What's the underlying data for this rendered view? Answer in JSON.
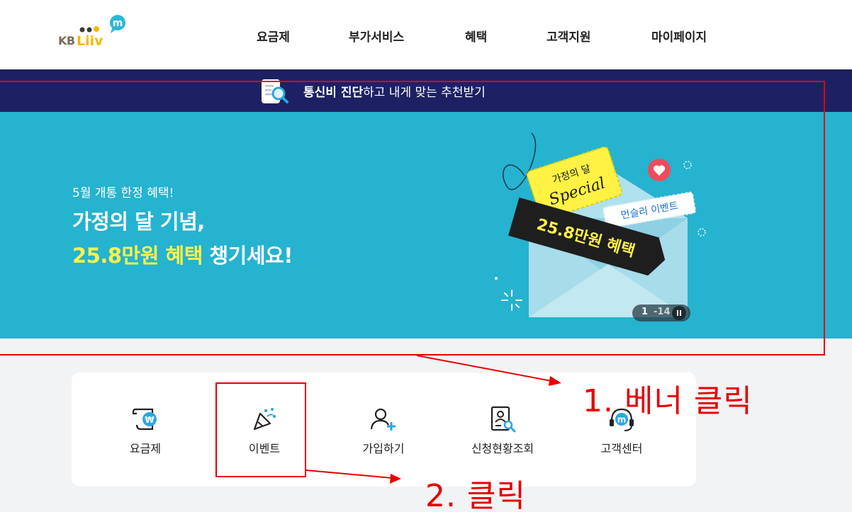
{
  "header": {
    "logo_prefix": "KB",
    "logo_brand": "Liiv M",
    "nav": [
      {
        "label": "요금제"
      },
      {
        "label": "부가서비스"
      },
      {
        "label": "혜택"
      },
      {
        "label": "고객지원"
      },
      {
        "label": "마이페이지"
      }
    ]
  },
  "diagnosis": {
    "bold_text": "통신비 진단",
    "rest_text": "하고 내게 맞는 추천받기",
    "icon": "document-search-icon"
  },
  "banner": {
    "subtitle": "5월 개통 한정 혜택!",
    "headline_line1": "가정의 달 기념,",
    "headline_highlight": "25.8만원 혜택",
    "headline_rest": " 챙기세요!",
    "art": {
      "tag1_line1": "가정의 달",
      "tag1_line2": "Special",
      "tag2": "먼슬리 이벤트",
      "tag3": "25.8만원 혜택"
    },
    "pager": {
      "current": "1",
      "total": "-14",
      "pause_icon": "pause-icon"
    },
    "colors": {
      "background": "#25b3cf",
      "highlight": "#fff14a"
    }
  },
  "quick_menu": {
    "items": [
      {
        "label": "요금제",
        "icon": "receipt-won-icon"
      },
      {
        "label": "이벤트",
        "icon": "party-popper-icon"
      },
      {
        "label": "가입하기",
        "icon": "user-add-icon"
      },
      {
        "label": "신청현황조회",
        "icon": "document-search-icon"
      },
      {
        "label": "고객센터",
        "icon": "headset-icon"
      }
    ]
  },
  "annotations": {
    "step1": "1. 베너 클릭",
    "step2": "2. 클릭",
    "color": "#e60000"
  }
}
